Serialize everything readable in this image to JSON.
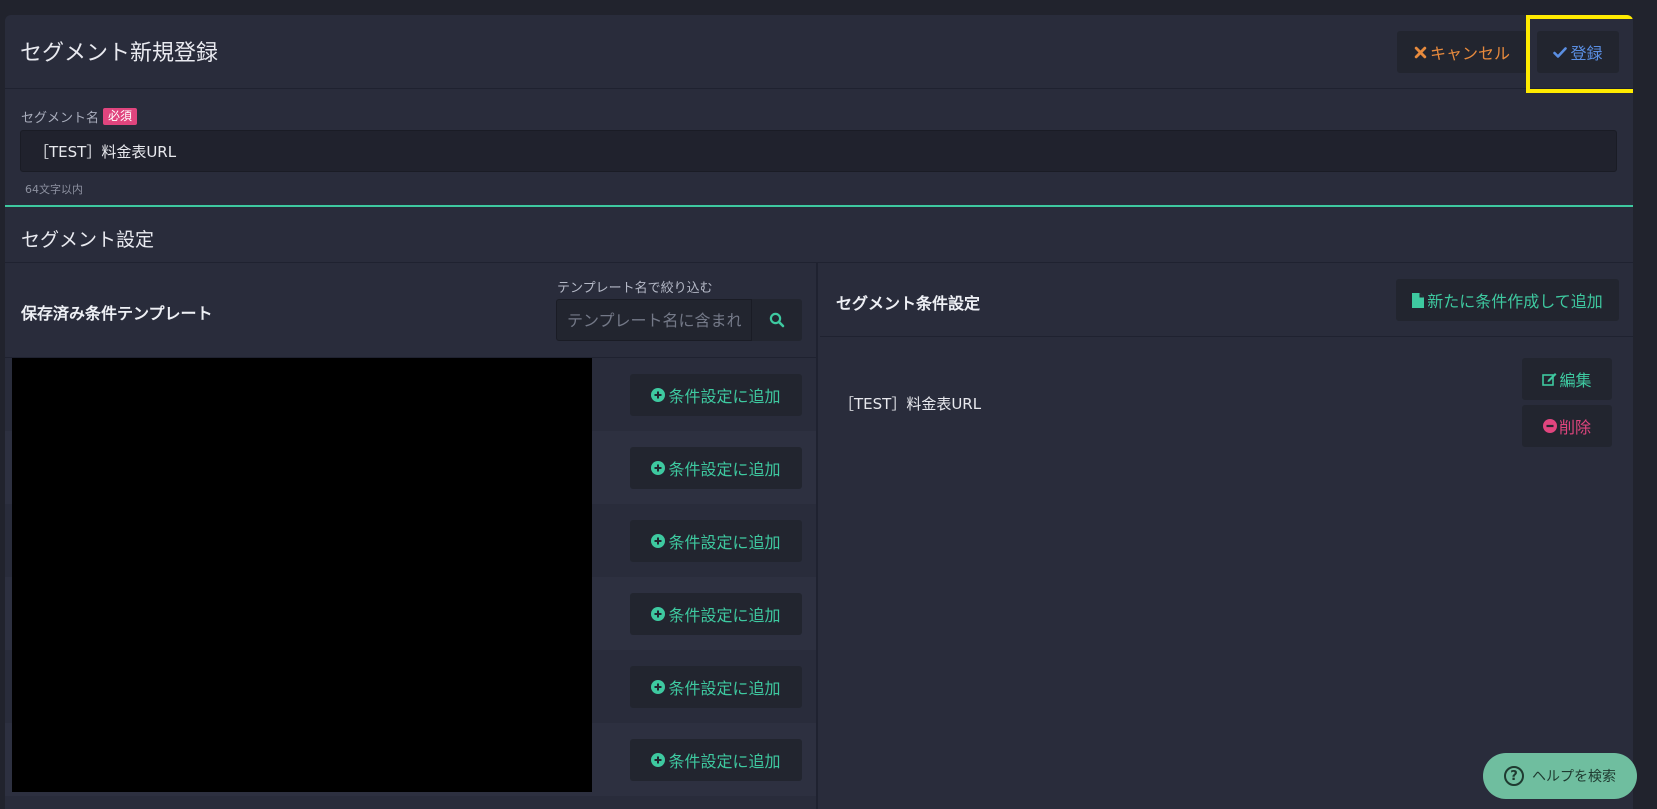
{
  "header": {
    "title": "セグメント新規登録",
    "cancel_label": "キャンセル",
    "register_label": "登録"
  },
  "segment_name": {
    "label": "セグメント名",
    "required_badge": "必須",
    "value": "［TEST］料金表URL",
    "hint": "64文字以内"
  },
  "segment_settings": {
    "title": "セグメント設定"
  },
  "templates": {
    "title": "保存済み条件テンプレート",
    "filter_label": "テンプレート名で絞り込む",
    "filter_placeholder": "テンプレート名に含まれ",
    "rows": [
      {
        "add_label": "条件設定に追加"
      },
      {
        "add_label": "条件設定に追加"
      },
      {
        "add_label": "条件設定に追加"
      },
      {
        "add_label": "条件設定に追加"
      },
      {
        "add_label": "条件設定に追加"
      },
      {
        "add_label": "条件設定に追加"
      }
    ]
  },
  "conditions": {
    "title": "セグメント条件設定",
    "new_label": "新たに条件作成して追加",
    "items": [
      {
        "name": "［TEST］料金表URL",
        "edit_label": "編集",
        "delete_label": "削除"
      }
    ]
  },
  "help": {
    "label": "ヘルプを検索"
  },
  "colors": {
    "accent": "#3ec9a0",
    "cancel": "#e78a3d",
    "register": "#5a8ee2",
    "danger": "#e0457e",
    "highlight": "#ffeb00"
  },
  "icons": [
    "times-icon",
    "check-icon",
    "search-icon",
    "plus-circle-icon",
    "file-icon",
    "edit-icon",
    "minus-circle-icon",
    "question-icon"
  ]
}
